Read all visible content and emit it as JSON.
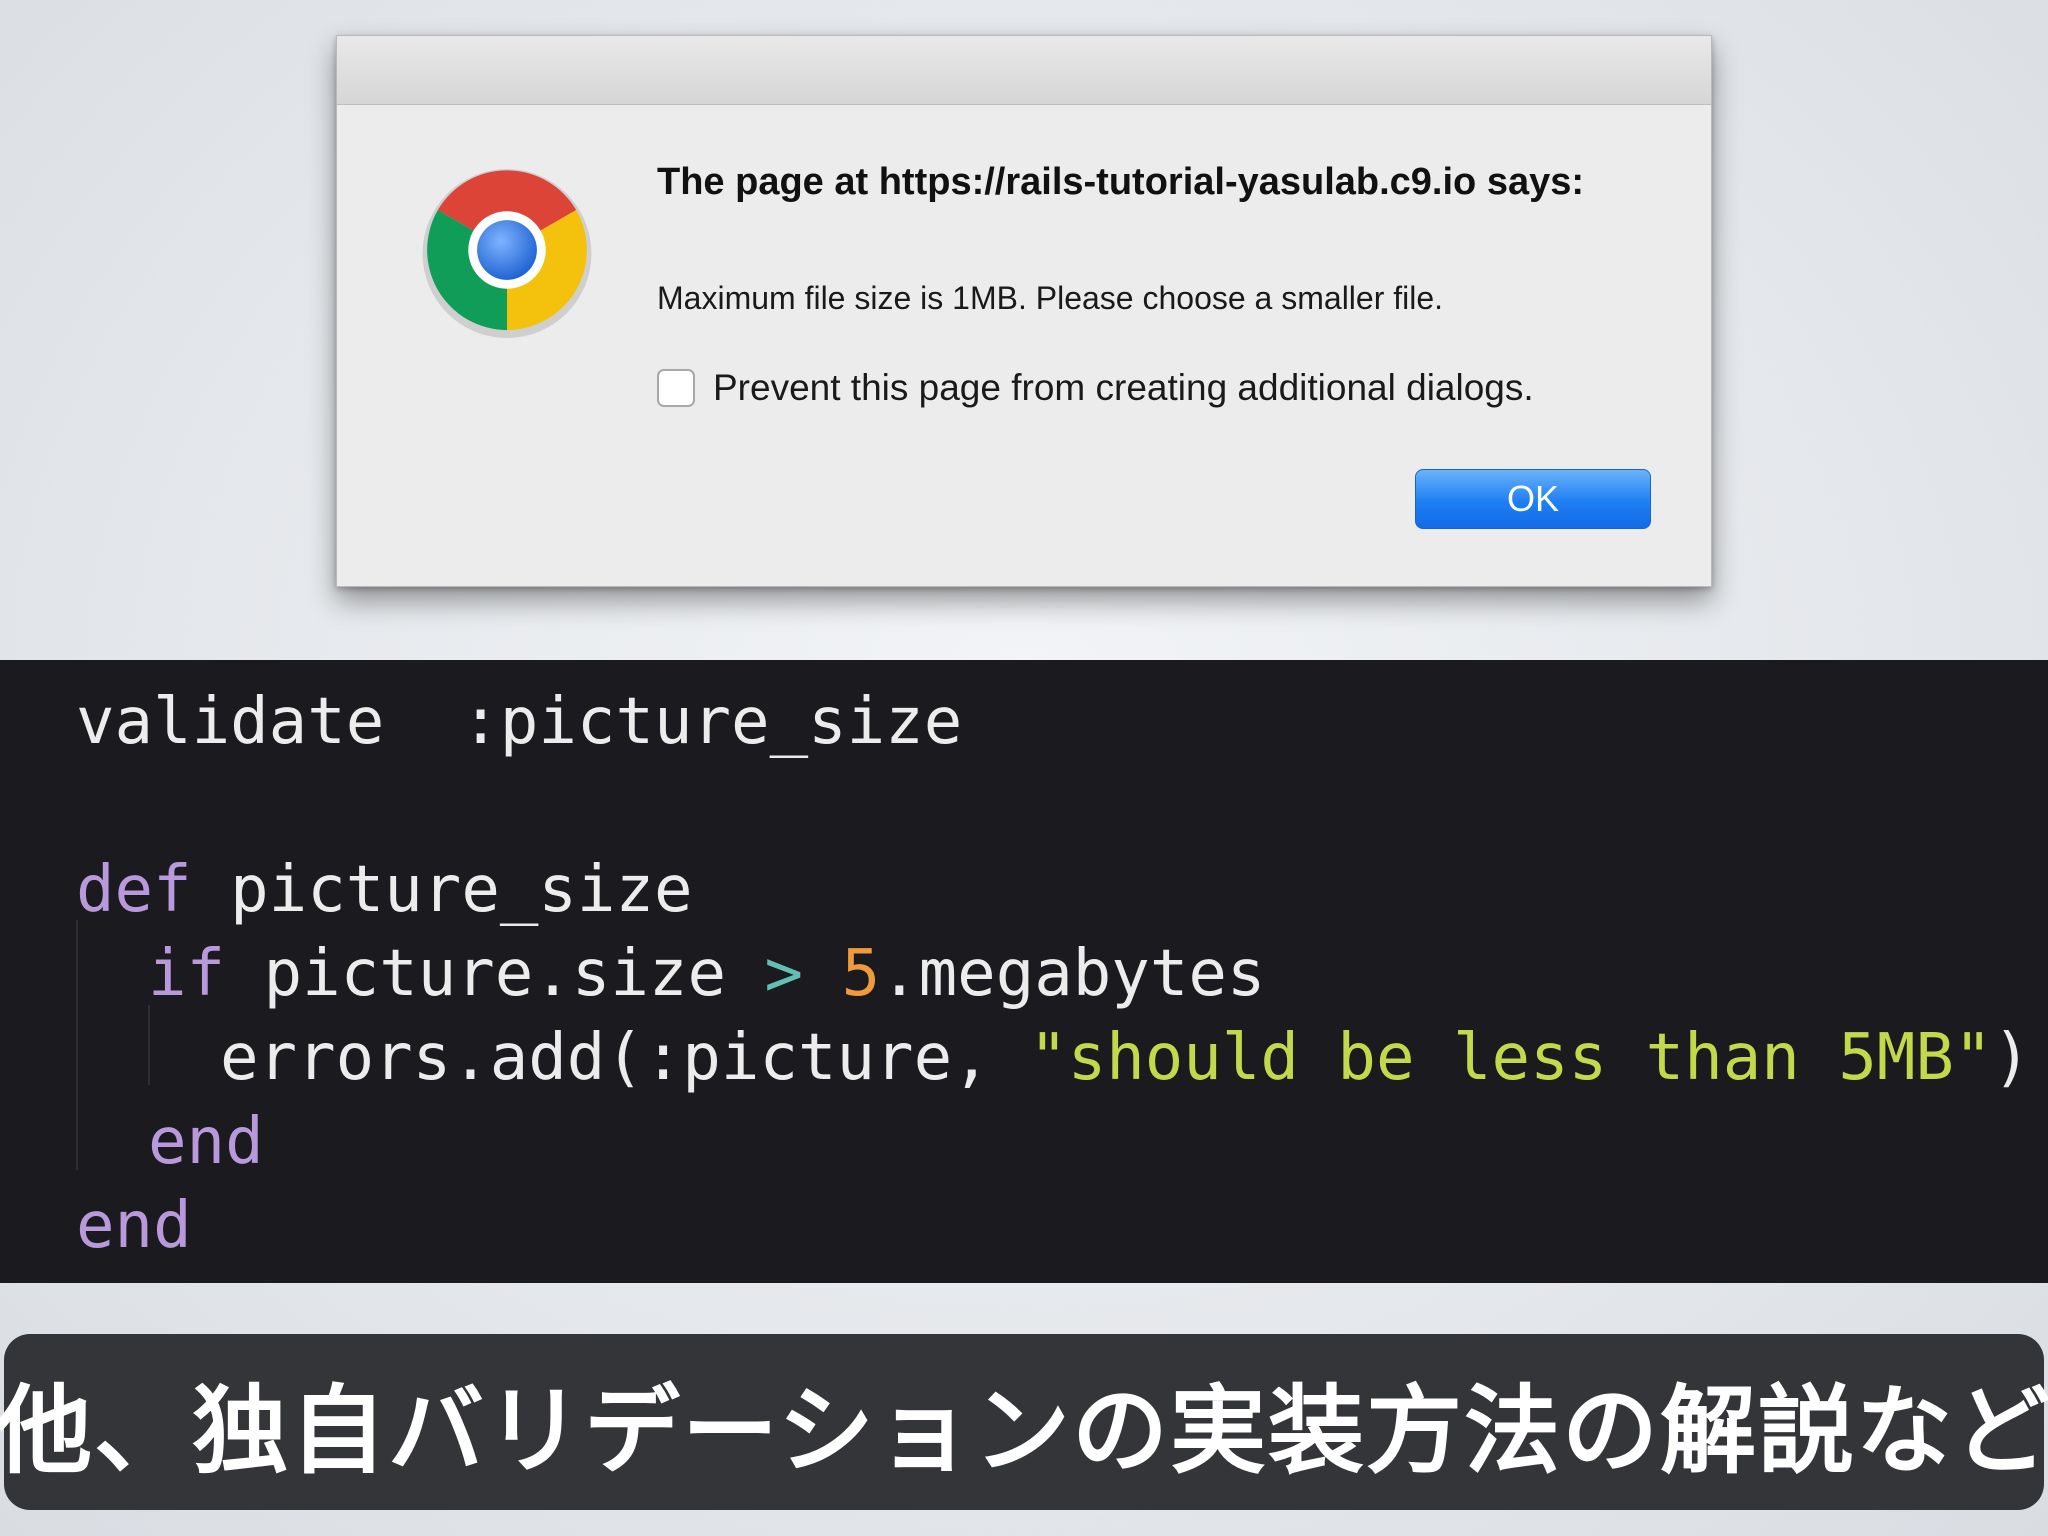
{
  "dialog": {
    "heading": "The page at https://rails-tutorial-yasulab.c9.io says:",
    "message": "Maximum file size is 1MB. Please choose a smaller file.",
    "prevent_label": "Prevent this page from creating additional dialogs.",
    "prevent_checked": false,
    "ok_label": "OK",
    "icon": "chrome-logo"
  },
  "code": {
    "line1": {
      "kw": "validate",
      "sym": ":picture_size"
    },
    "line2": {
      "kw": "def",
      "name": "picture_size"
    },
    "line3": {
      "kw": "if",
      "expr": "picture.size",
      "op": ">",
      "num": "5",
      "call": ".megabytes"
    },
    "line4": {
      "pre": "errors.add(:picture, ",
      "str": "\"should be less than 5MB\"",
      "post": ")"
    },
    "line5": {
      "kw": "end"
    },
    "line6": {
      "kw": "end"
    }
  },
  "caption": {
    "text": "他、独自バリデーションの実装方法の解説など"
  },
  "colors": {
    "code_bg": "#1b1b1f",
    "keyword": "#b999dc",
    "operator": "#62bfb3",
    "number": "#ef9a3c",
    "string": "#c3d94b",
    "ok_button": "#1e7ff3",
    "caption_bg": "#333538"
  }
}
